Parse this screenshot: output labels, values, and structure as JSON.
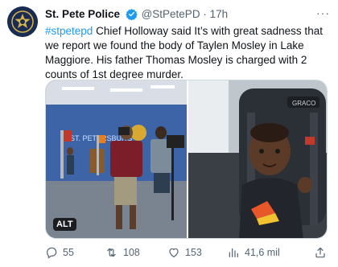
{
  "tweet": {
    "author_name": "St. Pete Police",
    "handle": "@StPetePD",
    "separator": "·",
    "time": "17h",
    "more_label": "···",
    "hashtag": "#stpetepd",
    "body": " Chief Holloway said It’s with great sadness that we report we found the body of Taylen Mosley in Lake Maggiore. His father Thomas Mosley is charged with 2 counts of 1st degree murder."
  },
  "media": {
    "alt_badge": "ALT"
  },
  "actions": {
    "replies": "55",
    "retweets": "108",
    "likes": "153",
    "views": "41,6 mil"
  },
  "colors": {
    "accent": "#1d9bf0",
    "muted": "#536471",
    "verified": "#1d9bf0"
  },
  "icons": [
    "police-badge-avatar",
    "verified-badge-icon",
    "more-icon",
    "reply-icon",
    "retweet-icon",
    "like-icon",
    "views-icon",
    "share-icon"
  ]
}
